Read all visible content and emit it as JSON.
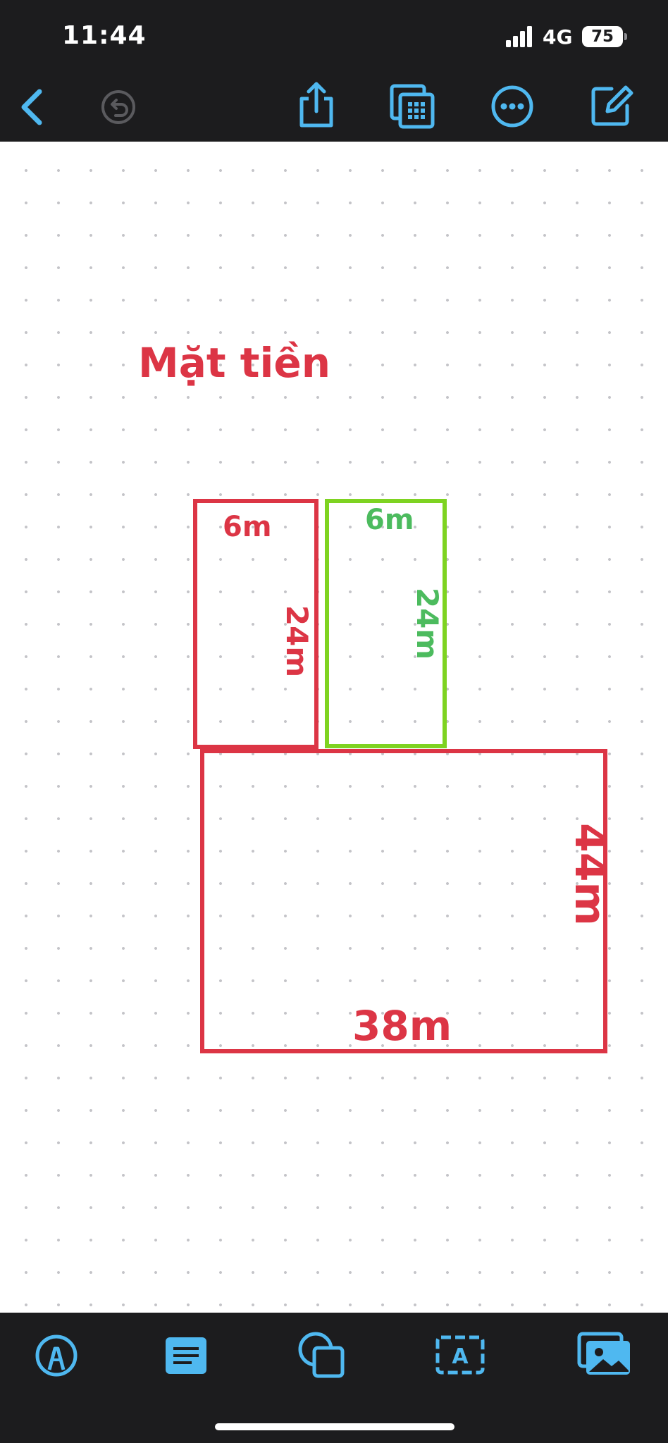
{
  "status_bar": {
    "time": "11:44",
    "network": "4G",
    "battery": "75",
    "icons": [
      "signal-bars-icon",
      "battery-icon"
    ]
  },
  "toolbar": {
    "items": [
      {
        "name": "back",
        "icon": "chevron-left-icon"
      },
      {
        "name": "undo",
        "icon": "undo-icon",
        "enabled": false
      },
      {
        "name": "share",
        "icon": "share-icon"
      },
      {
        "name": "page-grid",
        "icon": "page-grid-icon"
      },
      {
        "name": "more",
        "icon": "ellipsis-circle-icon"
      },
      {
        "name": "edit",
        "icon": "compose-icon"
      }
    ],
    "accent_color": "#4fb8f0"
  },
  "canvas": {
    "title": "Mặt tiền",
    "colors": {
      "red": "#dc3545",
      "green": "#7ed321"
    },
    "plots": {
      "red_left": {
        "width": "6m",
        "length": "24m"
      },
      "green": {
        "width": "6m",
        "length": "24m"
      },
      "large": {
        "width": "38m",
        "length": "44m"
      }
    }
  },
  "bottom_toolbar": {
    "items": [
      {
        "name": "markup",
        "icon": "markup-pen-icon"
      },
      {
        "name": "text-block",
        "icon": "text-block-icon"
      },
      {
        "name": "shapes",
        "icon": "shapes-icon"
      },
      {
        "name": "text-box",
        "icon": "text-box-icon"
      },
      {
        "name": "media",
        "icon": "photo-icon"
      }
    ]
  }
}
